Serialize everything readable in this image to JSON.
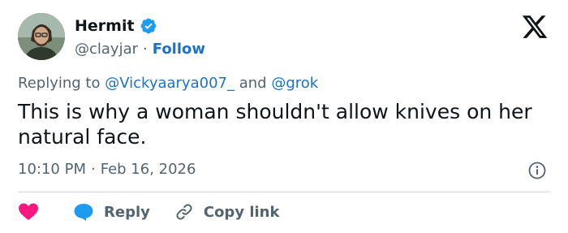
{
  "tweet": {
    "author": {
      "display_name": "Hermit",
      "handle": "@clayjar",
      "verified": true,
      "separator": "·",
      "follow_label": "Follow",
      "avatar_icon": "profile-photo"
    },
    "brand_icon": "x-logo-icon",
    "reply_context": {
      "prefix": "Replying to",
      "mention_1": "@Vickyaarya007_",
      "conjunction": "and",
      "mention_2": "@grok"
    },
    "text": "This is why a woman shouldn't allow knives on her natural face.",
    "time": "10:10 PM",
    "date_separator": "·",
    "date": "Feb 16, 2026",
    "info_icon": "info-icon",
    "actions": {
      "like_icon": "heart-icon",
      "reply_label": "Reply",
      "reply_icon": "speech-bubble-icon",
      "copy_label": "Copy link",
      "copy_icon": "link-icon"
    }
  },
  "colors": {
    "text_primary": "#0f1419",
    "text_secondary": "#536471",
    "link_blue": "#1d72c8",
    "verified_blue": "#1d9bf0",
    "heart_pink": "#f91880",
    "divider": "#cfd9de"
  }
}
